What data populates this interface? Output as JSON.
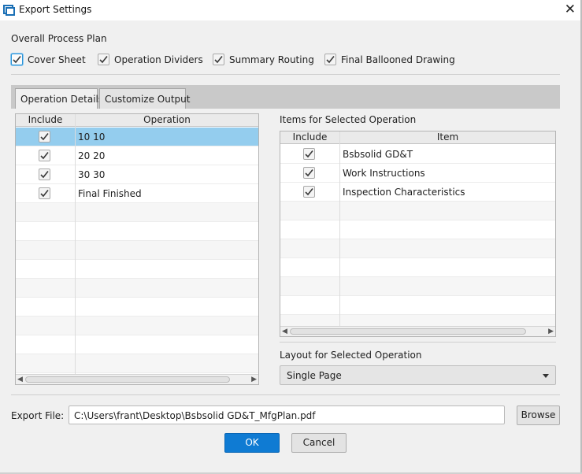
{
  "window": {
    "title": "Export Settings",
    "close_glyph": "✕"
  },
  "overall": {
    "label": "Overall Process Plan",
    "options": [
      {
        "label": "Cover Sheet",
        "checked": true,
        "focused": true
      },
      {
        "label": "Operation Dividers",
        "checked": true
      },
      {
        "label": "Summary Routing",
        "checked": true
      },
      {
        "label": "Final Ballooned Drawing",
        "checked": true
      }
    ]
  },
  "tabs": [
    {
      "label": "Operation Details",
      "active": true
    },
    {
      "label": "Customize Output",
      "active": false
    }
  ],
  "operations": {
    "columns": [
      "Include",
      "Operation"
    ],
    "rows": [
      {
        "include": true,
        "operation": "10 10",
        "selected": true
      },
      {
        "include": true,
        "operation": "20 20"
      },
      {
        "include": true,
        "operation": "30 30"
      },
      {
        "include": true,
        "operation": "Final Finished"
      }
    ]
  },
  "items": {
    "label": "Items for Selected Operation",
    "columns": [
      "Include",
      "Item"
    ],
    "rows": [
      {
        "include": true,
        "item": "Bsbsolid GD&T"
      },
      {
        "include": true,
        "item": "Work Instructions"
      },
      {
        "include": true,
        "item": "Inspection Characteristics"
      }
    ]
  },
  "layout": {
    "label": "Layout for Selected Operation",
    "value": "Single Page"
  },
  "export": {
    "label": "Export File:",
    "path": "C:\\Users\\frant\\Desktop\\Bsbsolid GD&T_MfgPlan.pdf",
    "browse": "Browse"
  },
  "buttons": {
    "ok": "OK",
    "cancel": "Cancel"
  },
  "colors": {
    "accent": "#0f7bd3",
    "selection": "#94cdee"
  }
}
